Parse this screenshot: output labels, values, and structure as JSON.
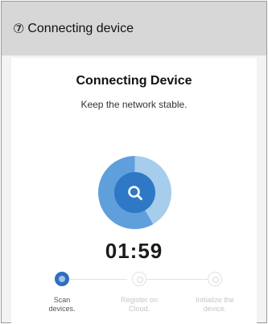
{
  "header": {
    "step_number": "⑦",
    "step_title": "Connecting device"
  },
  "screen": {
    "title": "Connecting Device",
    "subtitle": "Keep the network stable.",
    "scan_icon": "search-icon",
    "countdown": "01:59"
  },
  "steps": [
    {
      "label_line1": "Scan",
      "label_line2": "devices.",
      "state": "active"
    },
    {
      "label_line1": "Register on",
      "label_line2": "Cloud.",
      "state": "pending"
    },
    {
      "label_line1": "Initialize the",
      "label_line2": "device.",
      "state": "pending"
    }
  ],
  "colors": {
    "header_bg": "#d7d7d7",
    "accent": "#2e6fc2",
    "ring_light": "#a6cdec",
    "ring_mid": "#5f9fdc"
  }
}
